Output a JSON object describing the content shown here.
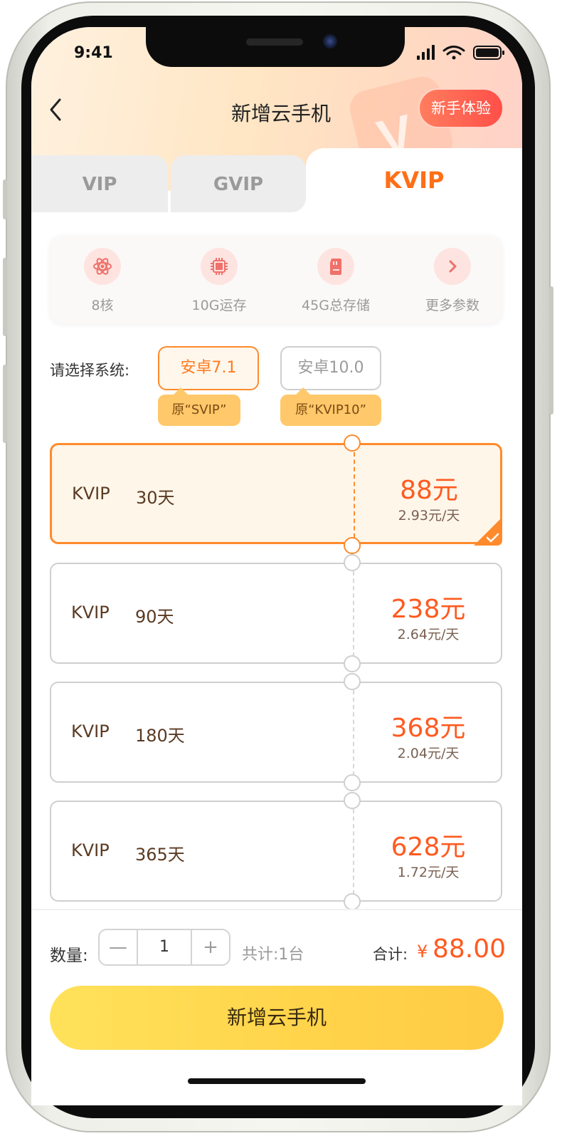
{
  "status_bar": {
    "time": "9:41"
  },
  "header": {
    "title": "新增云手机",
    "trial_button": "新手体验"
  },
  "tabs": [
    {
      "label": "VIP",
      "active": false
    },
    {
      "label": "GVIP",
      "active": false
    },
    {
      "label": "KVIP",
      "active": true
    }
  ],
  "specs": [
    {
      "label": "8核",
      "icon": "atom-icon"
    },
    {
      "label": "10G运存",
      "icon": "chip-icon"
    },
    {
      "label": "45G总存储",
      "icon": "sd-card-icon"
    },
    {
      "label": "更多参数",
      "icon": "chevron-right-icon"
    }
  ],
  "system": {
    "label": "请选择系统:",
    "options": [
      {
        "label": "安卓7.1",
        "tip": "原“SVIP”",
        "selected": true
      },
      {
        "label": "安卓10.0",
        "tip": "原“KVIP10”",
        "selected": false
      }
    ]
  },
  "plans": [
    {
      "name": "KVIP",
      "duration": "30天",
      "price": "88元",
      "daily": "2.93元/天",
      "selected": true
    },
    {
      "name": "KVIP",
      "duration": "90天",
      "price": "238元",
      "daily": "2.64元/天",
      "selected": false
    },
    {
      "name": "KVIP",
      "duration": "180天",
      "price": "368元",
      "daily": "2.04元/天",
      "selected": false
    },
    {
      "name": "KVIP",
      "duration": "365天",
      "price": "628元",
      "daily": "1.72元/天",
      "selected": false
    }
  ],
  "footer": {
    "quantity_label": "数量:",
    "minus": "—",
    "quantity": "1",
    "plus": "+",
    "total_units": "共计:1台",
    "sum_label": "合计:",
    "currency": "¥",
    "sum_value": "88.00",
    "submit": "新增云手机"
  },
  "colors": {
    "accent": "#ff7a1f",
    "price": "#ff5a1f",
    "cta": "#ffd34a",
    "tip": "#ffc86a"
  }
}
